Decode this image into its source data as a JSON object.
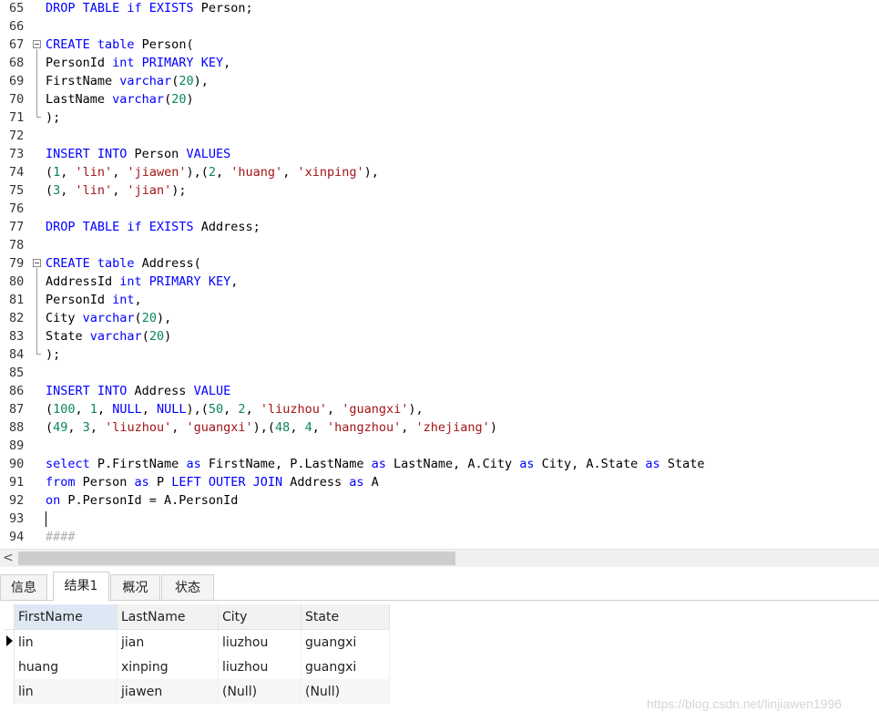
{
  "colors": {
    "keyword": "#0000ff",
    "string": "#a31515",
    "number": "#098658",
    "plain": "#000000",
    "comment": "#b0b0b0"
  },
  "editor": {
    "lines": [
      {
        "n": "65",
        "t": [
          [
            "k",
            "DROP TABLE if EXISTS"
          ],
          [
            "p",
            " Person;"
          ]
        ]
      },
      {
        "n": "66",
        "t": []
      },
      {
        "n": "67",
        "fold": "open",
        "t": [
          [
            "k",
            "CREATE table"
          ],
          [
            "p",
            " Person("
          ]
        ]
      },
      {
        "n": "68",
        "t": [
          [
            "p",
            "PersonId "
          ],
          [
            "k",
            "int PRIMARY KEY"
          ],
          [
            "p",
            ","
          ]
        ]
      },
      {
        "n": "69",
        "t": [
          [
            "p",
            "FirstName "
          ],
          [
            "k",
            "varchar"
          ],
          [
            "p",
            "("
          ],
          [
            "d",
            "20"
          ],
          [
            "p",
            "),"
          ]
        ]
      },
      {
        "n": "70",
        "t": [
          [
            "p",
            "LastName "
          ],
          [
            "k",
            "varchar"
          ],
          [
            "p",
            "("
          ],
          [
            "d",
            "20"
          ],
          [
            "p",
            ")"
          ]
        ]
      },
      {
        "n": "71",
        "fold": "end",
        "t": [
          [
            "p",
            ");"
          ]
        ]
      },
      {
        "n": "72",
        "t": []
      },
      {
        "n": "73",
        "t": [
          [
            "k",
            "INSERT INTO"
          ],
          [
            "p",
            " Person "
          ],
          [
            "k",
            "VALUES"
          ]
        ]
      },
      {
        "n": "74",
        "t": [
          [
            "p",
            "("
          ],
          [
            "d",
            "1"
          ],
          [
            "p",
            ", "
          ],
          [
            "s",
            "'lin'"
          ],
          [
            "p",
            ", "
          ],
          [
            "s",
            "'jiawen'"
          ],
          [
            "p",
            "),("
          ],
          [
            "d",
            "2"
          ],
          [
            "p",
            ", "
          ],
          [
            "s",
            "'huang'"
          ],
          [
            "p",
            ", "
          ],
          [
            "s",
            "'xinping'"
          ],
          [
            "p",
            "),"
          ]
        ]
      },
      {
        "n": "75",
        "t": [
          [
            "p",
            "("
          ],
          [
            "d",
            "3"
          ],
          [
            "p",
            ", "
          ],
          [
            "s",
            "'lin'"
          ],
          [
            "p",
            ", "
          ],
          [
            "s",
            "'jian'"
          ],
          [
            "p",
            ");"
          ]
        ]
      },
      {
        "n": "76",
        "t": []
      },
      {
        "n": "77",
        "t": [
          [
            "k",
            "DROP TABLE if EXISTS"
          ],
          [
            "p",
            " Address;"
          ]
        ]
      },
      {
        "n": "78",
        "t": []
      },
      {
        "n": "79",
        "fold": "open",
        "t": [
          [
            "k",
            "CREATE table"
          ],
          [
            "p",
            " Address("
          ]
        ]
      },
      {
        "n": "80",
        "t": [
          [
            "p",
            "AddressId "
          ],
          [
            "k",
            "int PRIMARY KEY"
          ],
          [
            "p",
            ","
          ]
        ]
      },
      {
        "n": "81",
        "t": [
          [
            "p",
            "PersonId "
          ],
          [
            "k",
            "int"
          ],
          [
            "p",
            ","
          ]
        ]
      },
      {
        "n": "82",
        "t": [
          [
            "p",
            "City "
          ],
          [
            "k",
            "varchar"
          ],
          [
            "p",
            "("
          ],
          [
            "d",
            "20"
          ],
          [
            "p",
            "),"
          ]
        ]
      },
      {
        "n": "83",
        "t": [
          [
            "p",
            "State "
          ],
          [
            "k",
            "varchar"
          ],
          [
            "p",
            "("
          ],
          [
            "d",
            "20"
          ],
          [
            "p",
            ")"
          ]
        ]
      },
      {
        "n": "84",
        "fold": "end",
        "t": [
          [
            "p",
            ");"
          ]
        ]
      },
      {
        "n": "85",
        "t": []
      },
      {
        "n": "86",
        "t": [
          [
            "k",
            "INSERT INTO"
          ],
          [
            "p",
            " Address "
          ],
          [
            "k",
            "VALUE"
          ]
        ]
      },
      {
        "n": "87",
        "t": [
          [
            "p",
            "("
          ],
          [
            "d",
            "100"
          ],
          [
            "p",
            ", "
          ],
          [
            "d",
            "1"
          ],
          [
            "p",
            ", "
          ],
          [
            "k",
            "NULL"
          ],
          [
            "p",
            ", "
          ],
          [
            "k",
            "NULL"
          ],
          [
            "p",
            "),("
          ],
          [
            "d",
            "50"
          ],
          [
            "p",
            ", "
          ],
          [
            "d",
            "2"
          ],
          [
            "p",
            ", "
          ],
          [
            "s",
            "'liuzhou'"
          ],
          [
            "p",
            ", "
          ],
          [
            "s",
            "'guangxi'"
          ],
          [
            "p",
            "),"
          ]
        ]
      },
      {
        "n": "88",
        "t": [
          [
            "p",
            "("
          ],
          [
            "d",
            "49"
          ],
          [
            "p",
            ", "
          ],
          [
            "d",
            "3"
          ],
          [
            "p",
            ", "
          ],
          [
            "s",
            "'liuzhou'"
          ],
          [
            "p",
            ", "
          ],
          [
            "s",
            "'guangxi'"
          ],
          [
            "p",
            "),("
          ],
          [
            "d",
            "48"
          ],
          [
            "p",
            ", "
          ],
          [
            "d",
            "4"
          ],
          [
            "p",
            ", "
          ],
          [
            "s",
            "'hangzhou'"
          ],
          [
            "p",
            ", "
          ],
          [
            "s",
            "'zhejiang'"
          ],
          [
            "p",
            ")"
          ]
        ]
      },
      {
        "n": "89",
        "t": []
      },
      {
        "n": "90",
        "t": [
          [
            "k",
            "select"
          ],
          [
            "p",
            " P.FirstName "
          ],
          [
            "k",
            "as"
          ],
          [
            "p",
            " FirstName, P.LastName "
          ],
          [
            "k",
            "as"
          ],
          [
            "p",
            " LastName, A.City "
          ],
          [
            "k",
            "as"
          ],
          [
            "p",
            " City, A.State "
          ],
          [
            "k",
            "as"
          ],
          [
            "p",
            " State"
          ]
        ]
      },
      {
        "n": "91",
        "t": [
          [
            "k",
            "from"
          ],
          [
            "p",
            " Person "
          ],
          [
            "k",
            "as"
          ],
          [
            "p",
            " P "
          ],
          [
            "k",
            "LEFT OUTER JOIN"
          ],
          [
            "p",
            " Address "
          ],
          [
            "k",
            "as"
          ],
          [
            "p",
            " A"
          ]
        ]
      },
      {
        "n": "92",
        "t": [
          [
            "k",
            "on"
          ],
          [
            "p",
            " P.PersonId = A.PersonId"
          ]
        ]
      },
      {
        "n": "93",
        "caret": true,
        "t": []
      },
      {
        "n": "94",
        "t": [
          [
            "c",
            "####"
          ]
        ]
      }
    ]
  },
  "scrollbar": {
    "left_arrow": "<"
  },
  "tabs": [
    {
      "label": "信息",
      "active": false
    },
    {
      "label": "结果1",
      "active": true
    },
    {
      "label": "概况",
      "active": false
    },
    {
      "label": "状态",
      "active": false
    }
  ],
  "results": {
    "columns": [
      "FirstName",
      "LastName",
      "City",
      "State"
    ],
    "rows": [
      [
        "lin",
        "jian",
        "liuzhou",
        "guangxi"
      ],
      [
        "huang",
        "xinping",
        "liuzhou",
        "guangxi"
      ],
      [
        "lin",
        "jiawen",
        "(Null)",
        "(Null)"
      ]
    ],
    "null_text": "(Null)"
  },
  "watermark": "https://blog.csdn.net/linjiawen1996"
}
